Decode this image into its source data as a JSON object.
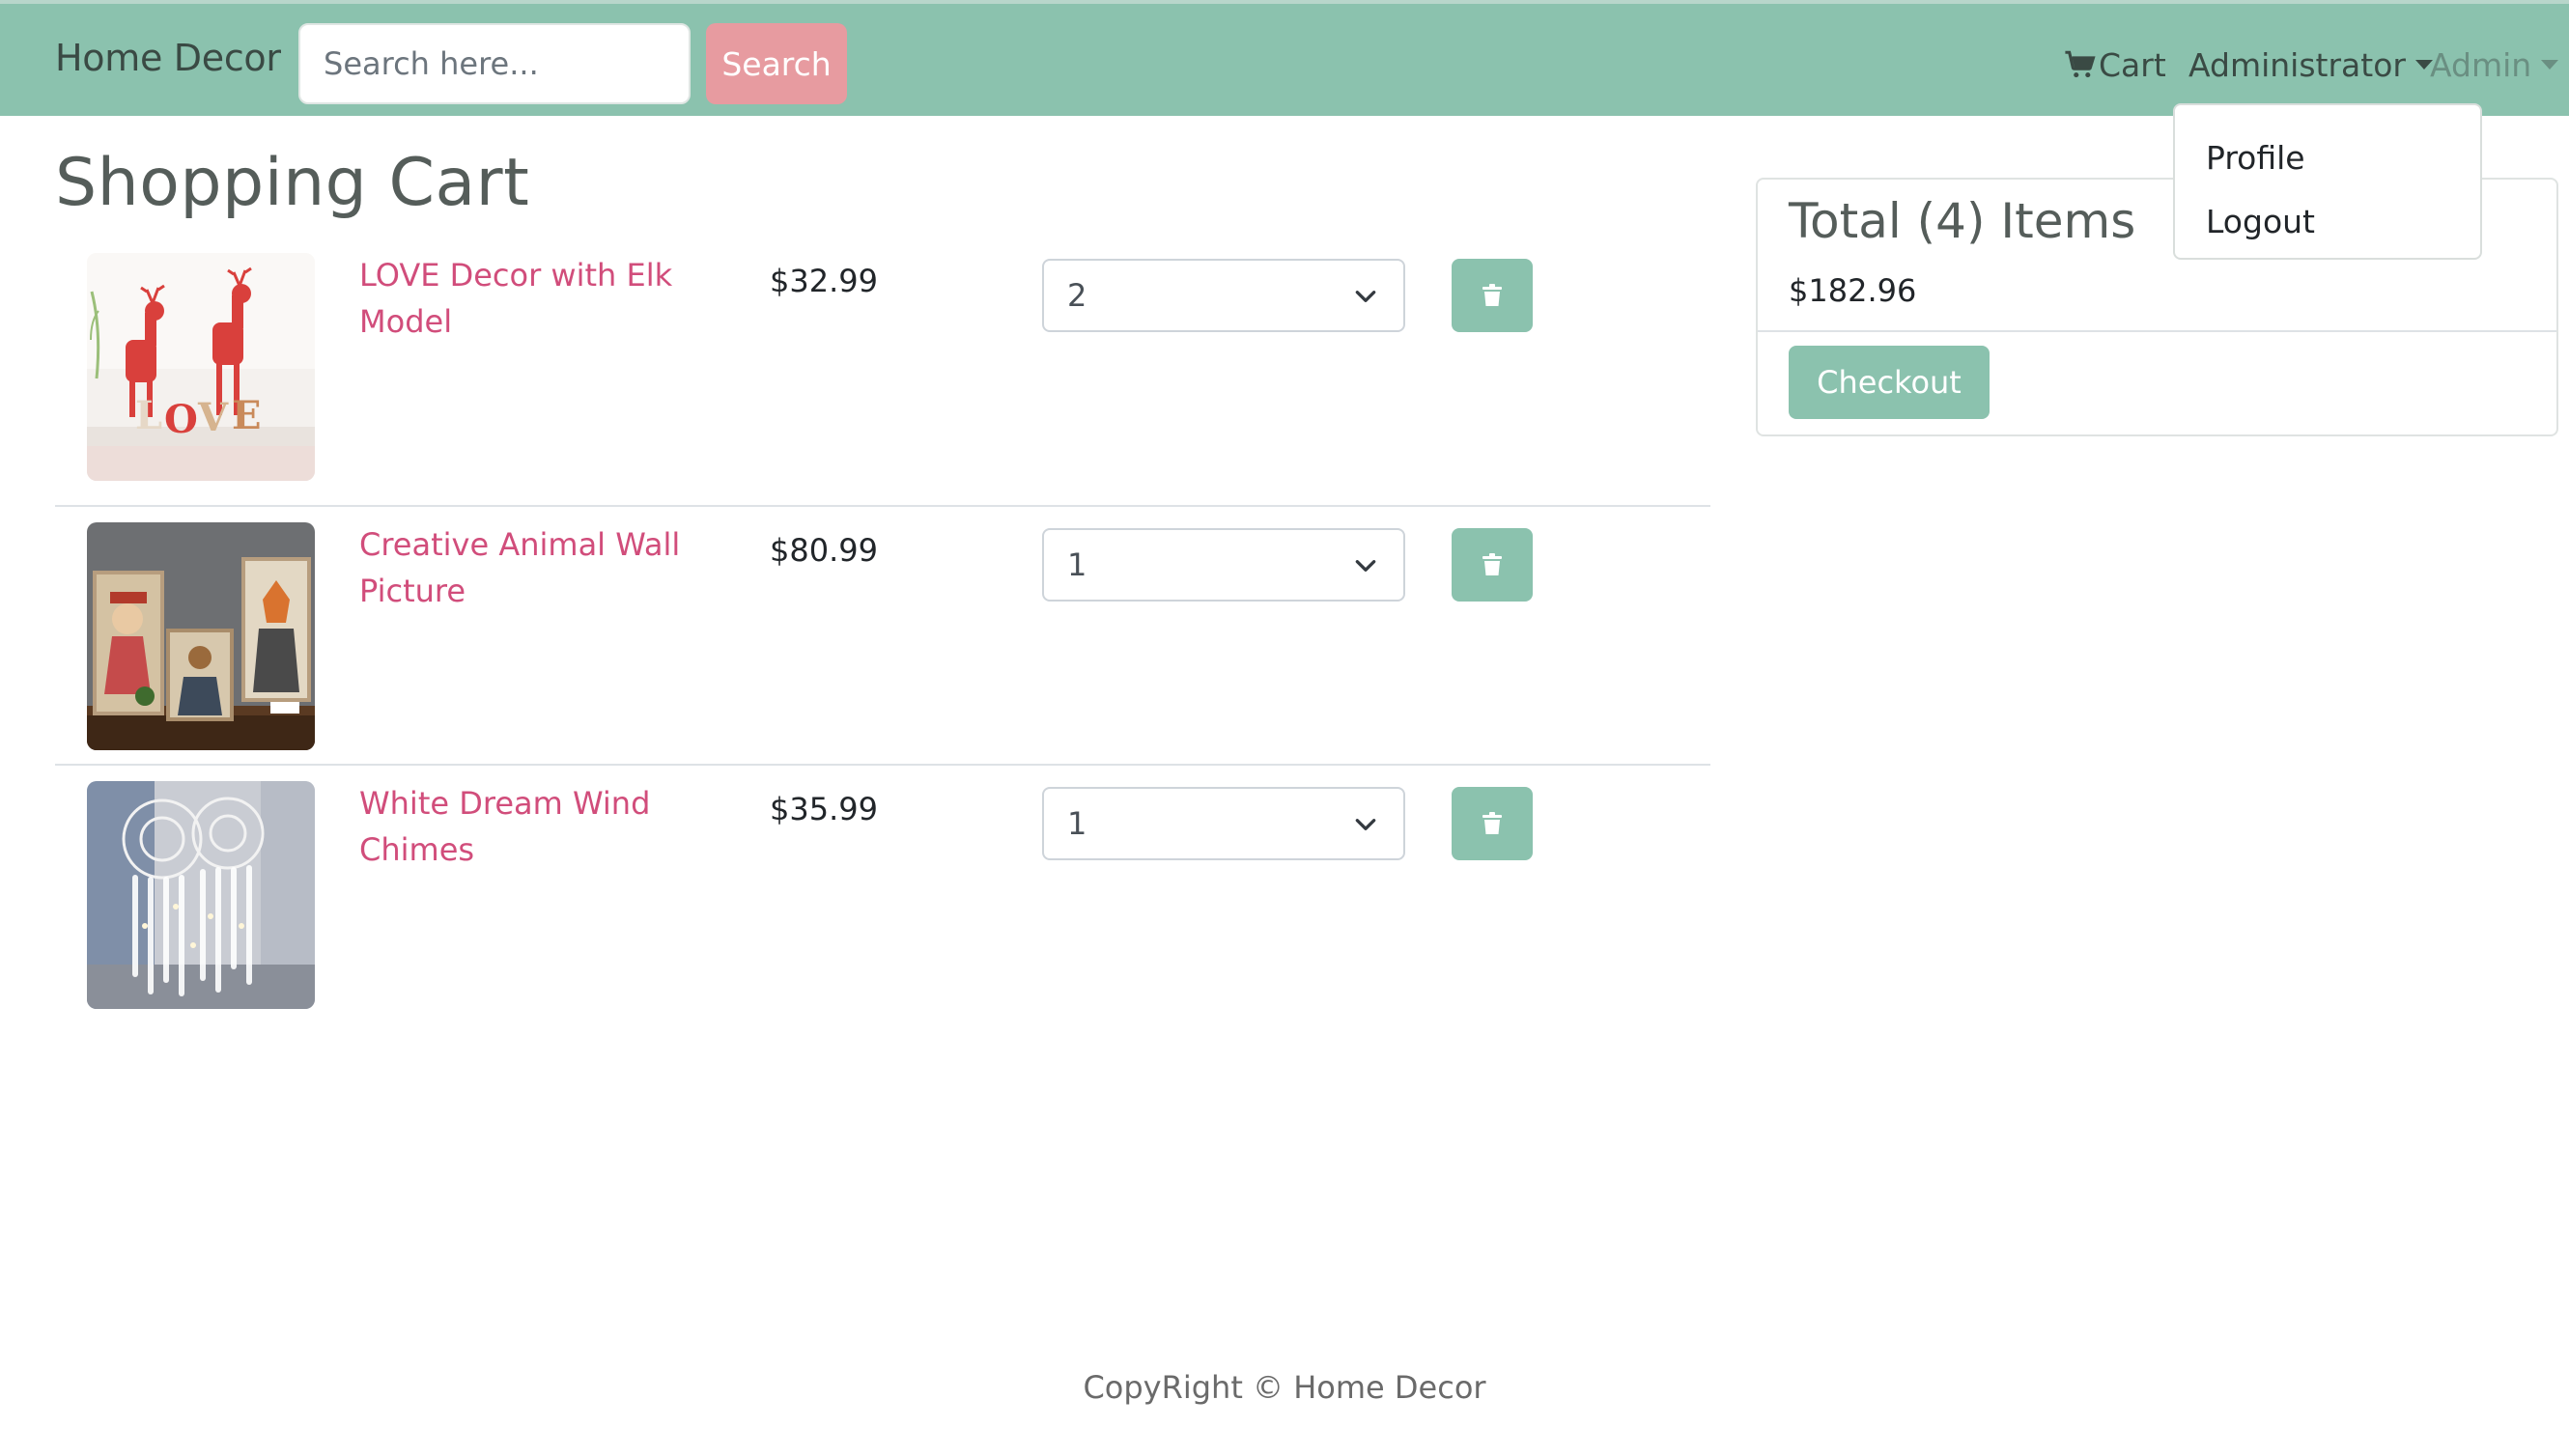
{
  "navbar": {
    "brand": "Home Decor",
    "search_placeholder": "Search here...",
    "search_label": "Search",
    "cart_label": "Cart",
    "administrator_label": "Administrator",
    "admin_label": "Admin"
  },
  "dropdown": {
    "items": [
      {
        "label": "Profile"
      },
      {
        "label": "Logout"
      }
    ]
  },
  "page": {
    "title": "Shopping Cart"
  },
  "cart": {
    "items": [
      {
        "name": "LOVE Decor with Elk Model",
        "price": "$32.99",
        "qty": "2",
        "image": "red-elk-love-figurines"
      },
      {
        "name": "Creative Animal Wall Picture",
        "price": "$80.99",
        "qty": "1",
        "image": "animal-portrait-paintings"
      },
      {
        "name": "White Dream Wind Chimes",
        "price": "$35.99",
        "qty": "1",
        "image": "white-dreamcatcher-chimes"
      }
    ]
  },
  "summary": {
    "title": "Total (4) Items",
    "total": "$182.96",
    "checkout_label": "Checkout"
  },
  "footer": {
    "text": "CopyRight © Home Decor"
  },
  "colors": {
    "navbar": "#8bc2ae",
    "search_button": "#e79ba0",
    "link": "#d14d7b",
    "accent_button": "#8bc2ae"
  }
}
